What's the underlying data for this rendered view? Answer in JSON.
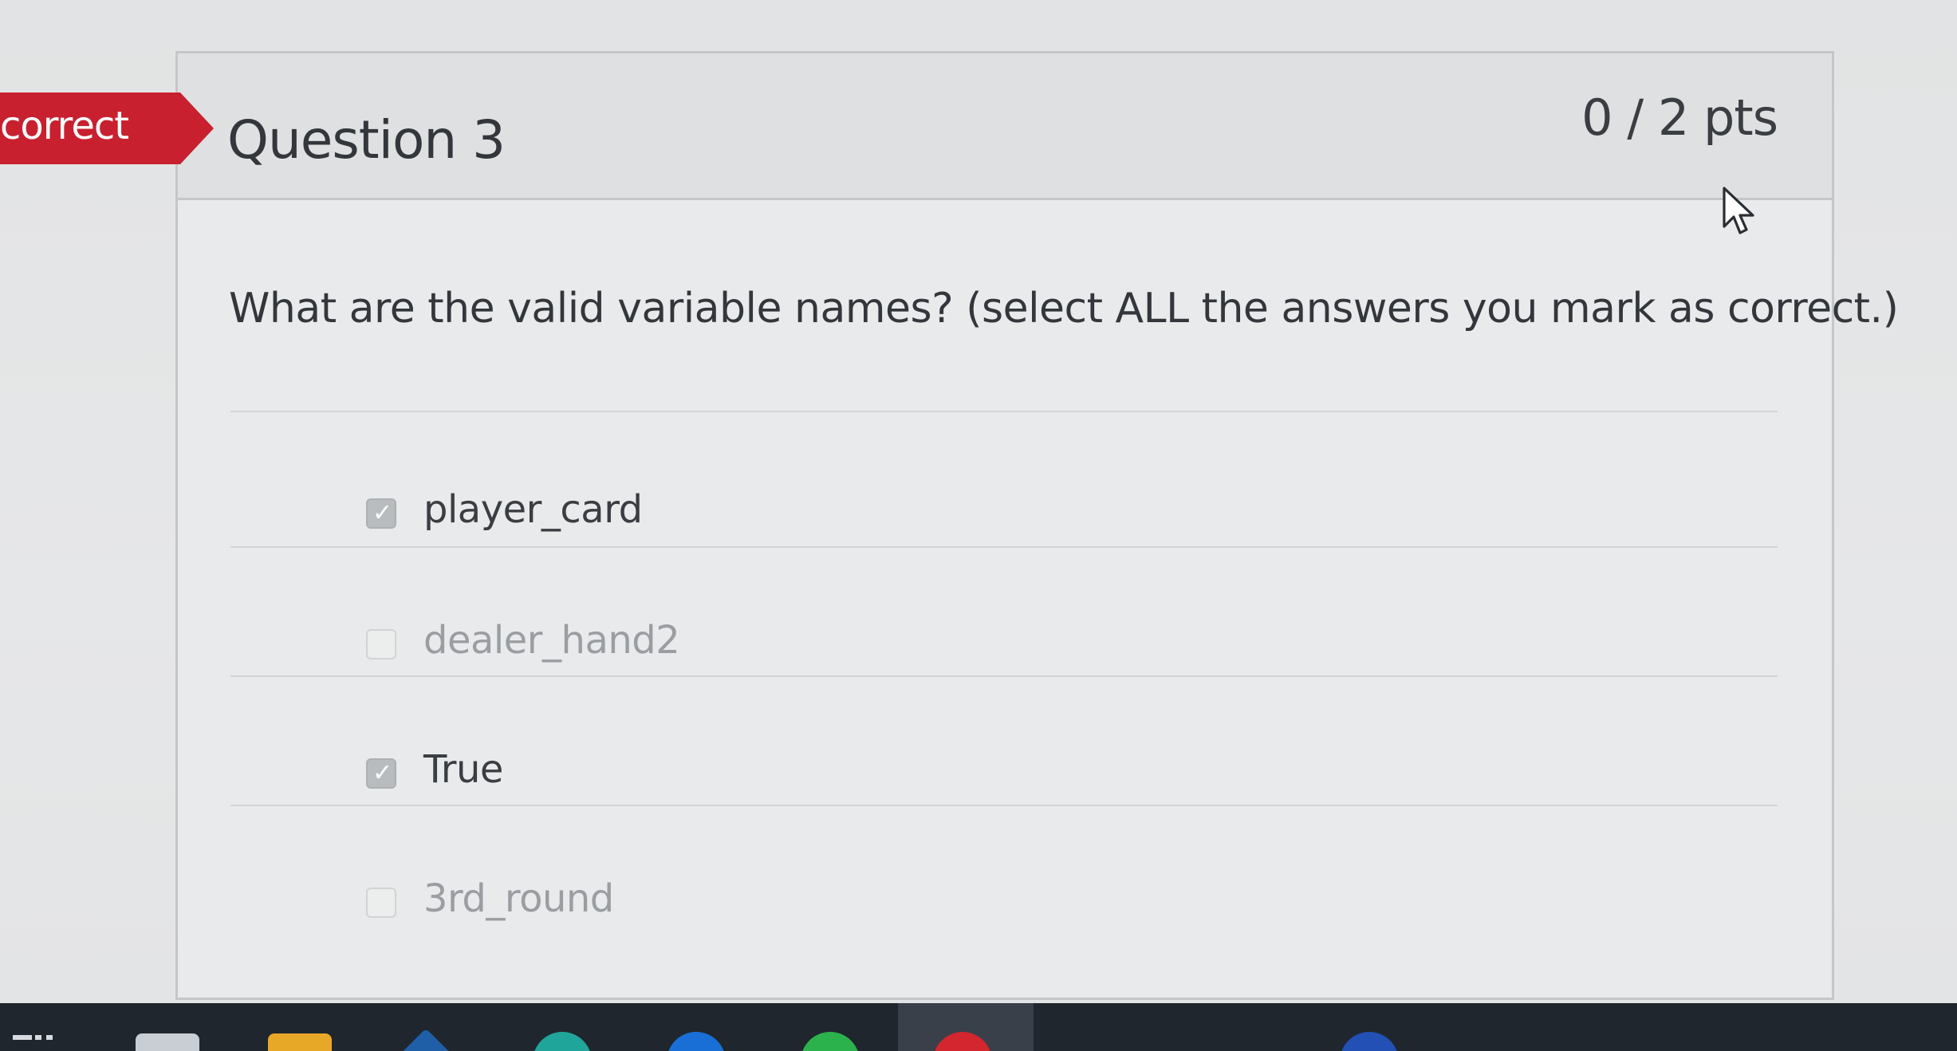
{
  "badge": {
    "label": "correct"
  },
  "question": {
    "title": "Question 3",
    "points": "0 / 2 pts",
    "prompt": "What are the valid variable names? (select ALL the answers you mark as correct.)"
  },
  "answers": [
    {
      "label": "player_card",
      "checked": true
    },
    {
      "label": "dealer_hand2",
      "checked": false
    },
    {
      "label": "True",
      "checked": true
    },
    {
      "label": "3rd_round",
      "checked": false
    }
  ],
  "colors": {
    "badge": "#c8202f",
    "checked_box": "#b9bcbf",
    "text": "#33373b",
    "taskbar": "#20262e"
  },
  "icons": {
    "checkbox_checked": "checkmark-icon",
    "cursor": "mouse-pointer-icon"
  },
  "taskbar": {
    "icons": [
      "widgets-icon",
      "folder-icon",
      "file-explorer-icon",
      "app-icon",
      "edge-browser-icon",
      "chrome-browser-icon",
      "app-icon"
    ]
  }
}
